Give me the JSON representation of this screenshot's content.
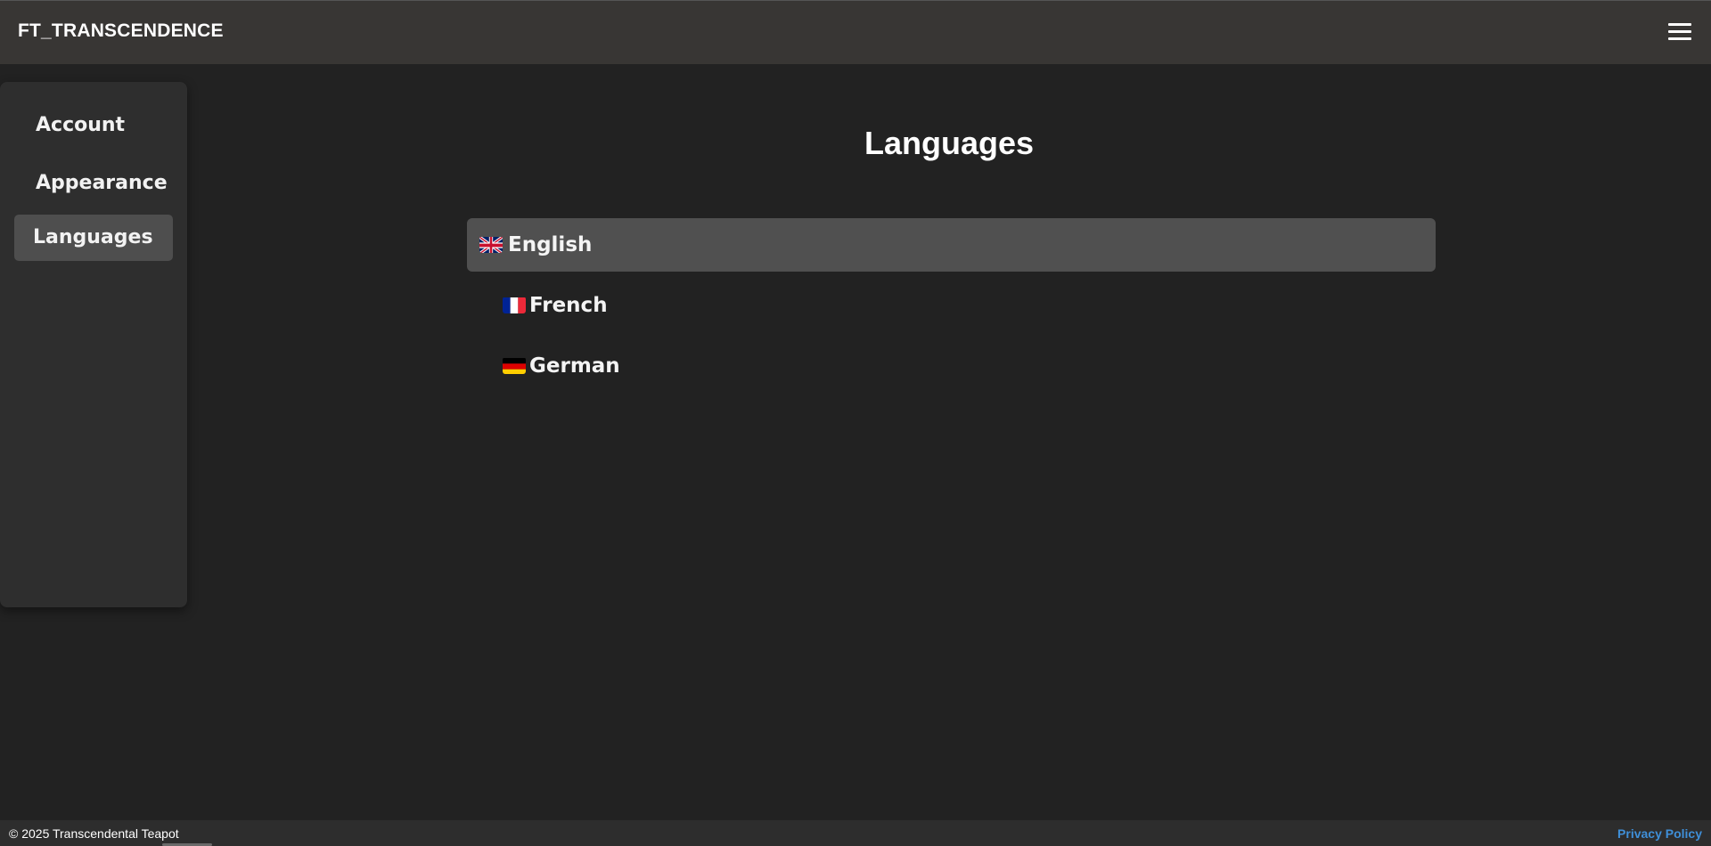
{
  "navbar": {
    "brand": "FT_TRANSCENDENCE",
    "menu_icon": "hamburger-menu-icon"
  },
  "sidebar": {
    "items": [
      {
        "label": "Account",
        "active": false
      },
      {
        "label": "Appearance",
        "active": false
      },
      {
        "label": "Languages",
        "active": true
      }
    ]
  },
  "main": {
    "title": "Languages",
    "languages": [
      {
        "label": "English",
        "flag": "uk-flag-icon",
        "selected": true
      },
      {
        "label": "French",
        "flag": "france-flag-icon",
        "selected": false
      },
      {
        "label": "German",
        "flag": "germany-flag-icon",
        "selected": false
      }
    ]
  },
  "footer": {
    "copyright": "© 2025 Transcendental Teapot",
    "privacy_link": "Privacy Policy"
  },
  "colors": {
    "background": "#222222",
    "navbar": "#383634",
    "sidebar": "#2e2e2e",
    "active_item": "#4e4e4e",
    "selected_language": "#505050",
    "footer": "#2d2d2d",
    "link": "#3f8fd8"
  }
}
